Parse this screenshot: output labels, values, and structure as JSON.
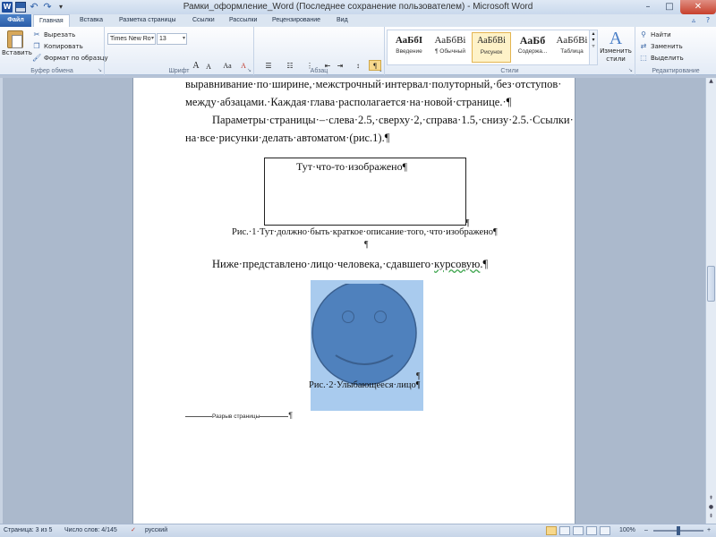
{
  "window": {
    "title": "Рамки_оформление_Word (Последнее сохранение пользователем) - Microsoft Word",
    "controls": {
      "minimize": "–",
      "maximize": "□",
      "close": "✕"
    }
  },
  "tabs": [
    {
      "label": "Файл"
    },
    {
      "label": "Главная",
      "active": true
    },
    {
      "label": "Вставка"
    },
    {
      "label": "Разметка страницы"
    },
    {
      "label": "Ссылки"
    },
    {
      "label": "Рассылки"
    },
    {
      "label": "Рецензирование"
    },
    {
      "label": "Вид"
    }
  ],
  "ribbon": {
    "clipboard": {
      "label": "Буфер обмена",
      "paste": "Вставить",
      "cut": "Вырезать",
      "copy": "Копировать",
      "format_painter": "Формат по образцу"
    },
    "font": {
      "label": "Шрифт",
      "name": "Times New Ro",
      "size": "13",
      "grow": "A",
      "shrink": "A",
      "case": "Aa",
      "clear": "A",
      "bold": "Ж",
      "italic": "К",
      "underline": "Ч",
      "strike": "abe",
      "subscript": "x₂",
      "superscript": "x²",
      "effects": "A",
      "highlight": "ab",
      "color": "A"
    },
    "paragraph": {
      "label": "Абзац",
      "pilcrow": "¶"
    },
    "styles": {
      "label": "Стили",
      "items": [
        {
          "sample": "АаБбІ",
          "name": "Введение"
        },
        {
          "sample": "АаБбВі",
          "name": "¶ Обычный"
        },
        {
          "sample": "АаБбВі",
          "name": "Рисунок",
          "selected": true
        },
        {
          "sample": "АаБб",
          "name": "Содержа..."
        },
        {
          "sample": "АаБбВі",
          "name": "Таблица"
        }
      ],
      "change_styles": "Изменить стили"
    },
    "editing": {
      "label": "Редактирование",
      "find": "Найти",
      "replace": "Заменить",
      "select": "Выделить"
    }
  },
  "document": {
    "line1": "выравнивание·по·ширине,·межстрочный·интервал·полуторный,·без·отступов·",
    "line2": "между·абзацами.·Каждая·глава·располагается·на·новой·странице.·¶",
    "line3": "Параметры·страницы·–·слева·2.5,·сверху·2,·справа·1.5,·снизу·2.5.·Ссылки·",
    "line4": "на·все·рисунки·делать·автоматом·(рис.1).¶",
    "figure_text": "Тут·что-то·изображено¶",
    "figure_pilcrow": "¶",
    "caption1": "Рис.·1·Тут·должно·быть·краткое·описание·того,·что·изображено¶",
    "empty_para": "¶",
    "line5_pre": "Ниже·представлено·лицо·человека,·сдавшего·",
    "line5_word": "курсовую",
    "line5_post": ".¶",
    "face_pilcrow": "¶",
    "caption2": "Рис.·2·Улыбающееся·лицо¶",
    "page_break": "Разрыв страницы",
    "page_break_pilcrow": "¶"
  },
  "status_bar": {
    "page": "Страница: 3 из 5",
    "words": "Число слов: 4/145",
    "language": "русский",
    "zoom": "100%",
    "zoom_minus": "–",
    "zoom_plus": "+"
  },
  "colors": {
    "face_fill": "#4f81bd",
    "face_stroke": "#3a5f8e",
    "selection": "#a9cbee",
    "ribbon_accent": "#2b5ca8"
  }
}
